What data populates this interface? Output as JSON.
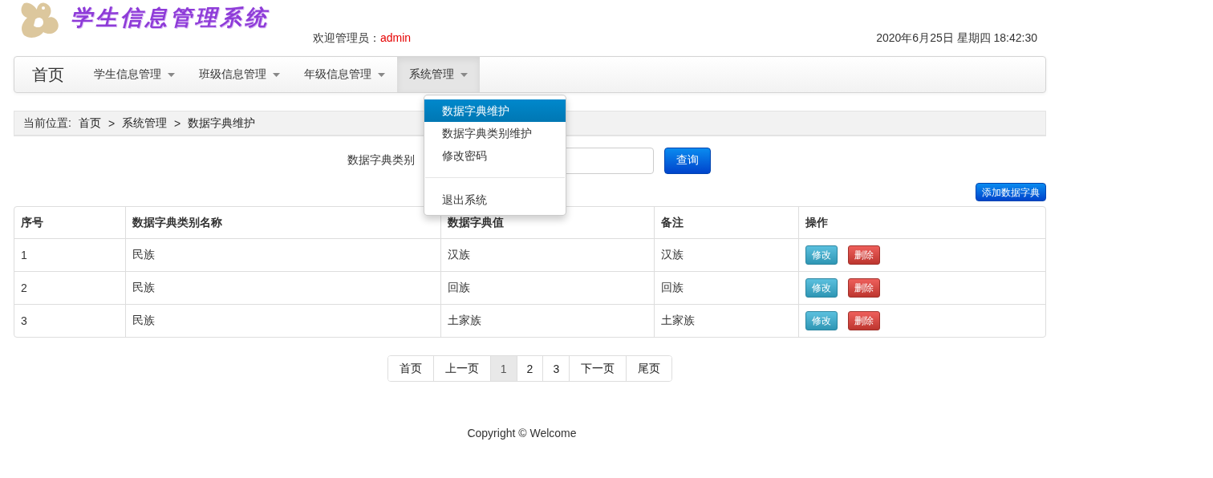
{
  "header": {
    "title": "学生信息管理系统",
    "welcome_label": "欢迎管理员：",
    "user": "admin",
    "datetime": "2020年6月25日 星期四 18:42:30"
  },
  "nav": {
    "brand": "首页",
    "items": [
      {
        "label": "学生信息管理",
        "selected": false
      },
      {
        "label": "班级信息管理",
        "selected": false
      },
      {
        "label": "年级信息管理",
        "selected": false
      },
      {
        "label": "系统管理",
        "selected": true
      }
    ]
  },
  "dropdown": {
    "groups": [
      [
        {
          "label": "数据字典维护",
          "selected": true
        },
        {
          "label": "数据字典类别维护",
          "selected": false
        },
        {
          "label": "修改密码",
          "selected": false
        }
      ],
      [
        {
          "label": "退出系统",
          "selected": false
        }
      ]
    ]
  },
  "breadcrumb": {
    "label": "当前位置:",
    "items": [
      "首页",
      "系统管理",
      "数据字典维护"
    ],
    "separator": ">"
  },
  "search": {
    "label": "数据字典类别",
    "button": "查询"
  },
  "add_button": "添加数据字典",
  "table": {
    "columns": [
      "序号",
      "数据字典类别名称",
      "数据字典值",
      "备注",
      "操作"
    ],
    "rows": [
      {
        "cells": [
          "1",
          "民族",
          "汉族",
          "汉族"
        ],
        "actions": [
          "修改",
          "删除"
        ]
      },
      {
        "cells": [
          "2",
          "民族",
          "回族",
          "回族"
        ],
        "actions": [
          "修改",
          "删除"
        ]
      },
      {
        "cells": [
          "3",
          "民族",
          "土家族",
          "土家族"
        ],
        "actions": [
          "修改",
          "删除"
        ]
      }
    ]
  },
  "pagination": [
    {
      "label": "首页",
      "selected": false
    },
    {
      "label": "上一页",
      "selected": false
    },
    {
      "label": "1",
      "selected": true
    },
    {
      "label": "2",
      "selected": false
    },
    {
      "label": "3",
      "selected": false
    },
    {
      "label": "下一页",
      "selected": false
    },
    {
      "label": "尾页",
      "selected": false
    }
  ],
  "footer": "Copyright © Welcome"
}
